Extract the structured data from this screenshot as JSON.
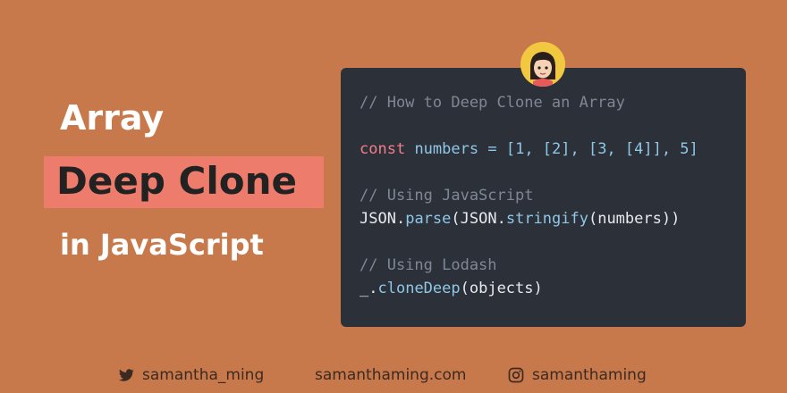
{
  "title": {
    "line1": "Array",
    "line2": "Deep Clone",
    "line3": "in JavaScript"
  },
  "code": {
    "line1": "// How to Deep Clone an Array",
    "line2_keyword": "const",
    "line2_var": "numbers",
    "line2_op": "=",
    "line2_value": "[1, [2], [3, [4]], 5]",
    "line3": "// Using JavaScript",
    "line4_obj1": "JSON",
    "line4_method1": "parse",
    "line4_open1": "(",
    "line4_obj2": "JSON",
    "line4_method2": "stringify",
    "line4_args": "(numbers))",
    "line5": "// Using Lodash",
    "line6_obj": "_",
    "line6_method": "cloneDeep",
    "line6_args": "(objects)"
  },
  "footer": {
    "twitter_icon": "twitter-icon",
    "twitter": "samantha_ming",
    "website": "samanthaming.com",
    "instagram_icon": "instagram-icon",
    "instagram": "samanthaming"
  },
  "colors": {
    "background": "#c8794b",
    "highlight": "#ee7c6c",
    "code_background": "#2c3039",
    "keyword": "#f17f89",
    "identifier": "#8fc8e6",
    "comment": "#7f8795",
    "avatar_ring": "#f2c840"
  }
}
